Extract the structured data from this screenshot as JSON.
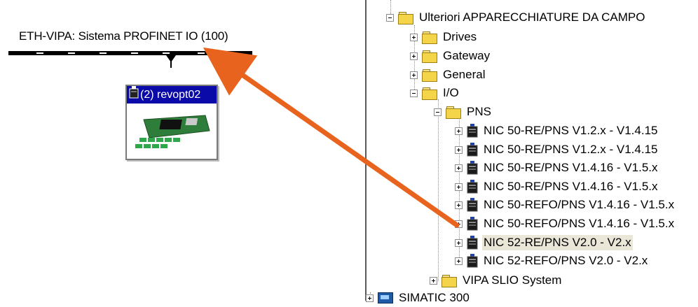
{
  "network": {
    "bus_label": "ETH-VIPA: Sistema PROFINET IO (100)",
    "device_title": "(2) revopt02"
  },
  "tree": {
    "root": "Ulteriori APPARECCHIATURE DA CAMPO",
    "folders": {
      "drives": "Drives",
      "gateway": "Gateway",
      "general": "General",
      "io": "I/O",
      "pns": "PNS",
      "vipa_slio": "VIPA SLIO System"
    },
    "devices": [
      "NIC 50-RE/PNS V1.2.x - V1.4.15",
      "NIC 50-RE/PNS V1.2.x - V1.4.15",
      "NIC 50-RE/PNS V1.4.16 - V1.5.x",
      "NIC 50-RE/PNS V1.4.16 - V1.5.x",
      "NIC 50-REFO/PNS V1.4.16 - V1.5.x",
      "NIC 50-REFO/PNS V1.4.16 - V1.5.x",
      "NIC 52-RE/PNS V2.0 - V2.x",
      "NIC 52-REFO/PNS V2.0 - V2.x"
    ],
    "selected_device_index": 6,
    "simatic": "SIMATIC 300"
  },
  "colors": {
    "arrow": "#e8641e",
    "device_title_bg": "#0a0aa8",
    "selection_bg": "#ebe7d8"
  }
}
